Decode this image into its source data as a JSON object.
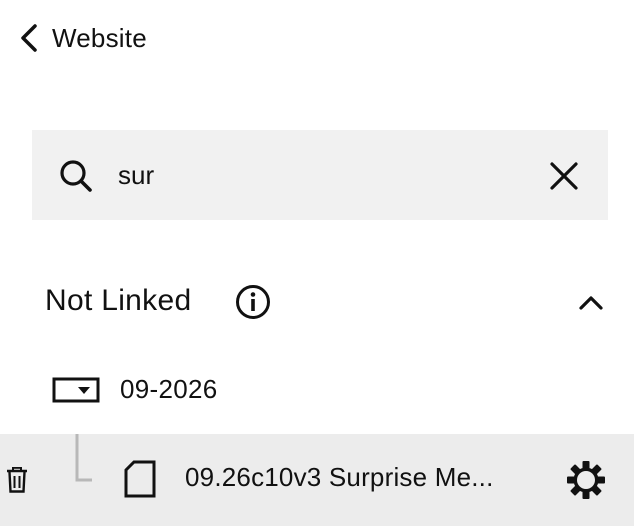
{
  "header": {
    "back_label": "Website",
    "back_icon": "chevron-left-icon"
  },
  "search": {
    "value": "sur",
    "search_icon": "search-icon",
    "clear_icon": "close-icon"
  },
  "section": {
    "title": "Not Linked",
    "info_icon": "info-icon",
    "toggle_icon": "chevron-up-icon",
    "expanded": true
  },
  "folder": {
    "label": "09-2026",
    "icon": "folder-dropdown-icon"
  },
  "page_item": {
    "label": "09.26c10v3 Surprise Me...",
    "icon": "page-icon",
    "delete_icon": "trash-icon",
    "settings_icon": "gear-icon",
    "selected": true
  },
  "colors": {
    "search_background": "#f1f1f1",
    "selected_row_background": "#ececec",
    "text": "#111111",
    "tree_line": "#b8b8b8"
  }
}
